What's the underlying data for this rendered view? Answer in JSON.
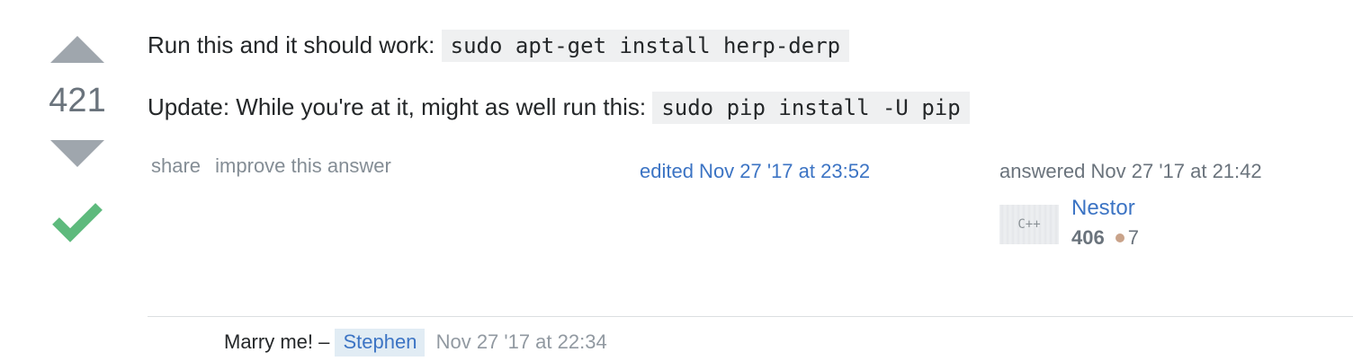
{
  "vote": {
    "count": "421"
  },
  "post": {
    "line1_text": "Run this and it should work:",
    "line1_code": "sudo apt-get install herp-derp",
    "line2_text": "Update: While you're at it, might as well run this:",
    "line2_code": "sudo pip install -U pip"
  },
  "menu": {
    "share": "share",
    "improve": "improve this answer"
  },
  "edited": "edited Nov 27 '17 at 23:52",
  "author": {
    "answered": "answered Nov 27 '17 at 21:42",
    "avatar_text": "C++",
    "name": "Nestor",
    "reputation": "406",
    "bronze_badges": "7"
  },
  "comment": {
    "text": "Marry me! –",
    "user": "Stephen",
    "date": "Nov 27 '17 at 22:34"
  },
  "colors": {
    "accepted": "#5eba7d",
    "link": "#3c74c4",
    "vote_arrow": "#9fa6ad",
    "bronze": "#c9a38a"
  },
  "icons": {
    "upvote": "upvote-arrow-icon",
    "downvote": "downvote-arrow-icon",
    "accepted": "checkmark-icon",
    "bronze": "bronze-badge-icon"
  }
}
